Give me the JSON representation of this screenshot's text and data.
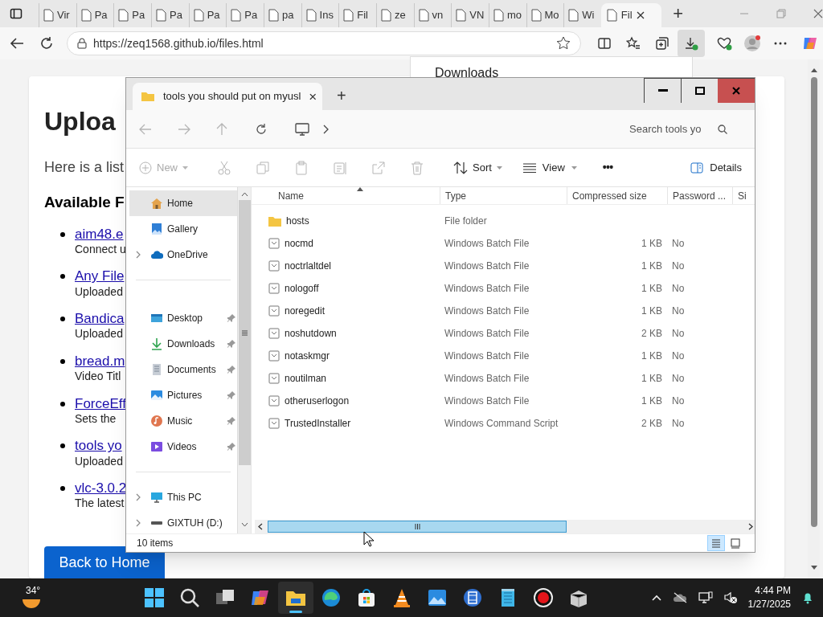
{
  "browser": {
    "tabs": [
      {
        "label": "Vir",
        "selected": false
      },
      {
        "label": "Pa",
        "selected": false
      },
      {
        "label": "Pa",
        "selected": false
      },
      {
        "label": "Pa",
        "selected": false
      },
      {
        "label": "Pa",
        "selected": false
      },
      {
        "label": "Pa",
        "selected": false
      },
      {
        "label": "pa",
        "selected": false
      },
      {
        "label": "Ins",
        "selected": false
      },
      {
        "label": "Fil",
        "selected": false
      },
      {
        "label": "ze",
        "selected": false
      },
      {
        "label": "vn",
        "selected": false
      },
      {
        "label": "VN",
        "selected": false
      },
      {
        "label": "mo",
        "selected": false
      },
      {
        "label": "Mo",
        "selected": false
      },
      {
        "label": "Wi",
        "selected": false
      },
      {
        "label": "Fil",
        "selected": true
      }
    ],
    "new_tab": "+",
    "url": "https://zeq1568.github.io/files.html",
    "downloads_panel": {
      "title": "Downloads"
    }
  },
  "page": {
    "heading": "Uploa",
    "intro": "Here is a list",
    "subheading": "Available F",
    "files": [
      {
        "link": "aim48.e",
        "note": "Connect u"
      },
      {
        "link": "Any File",
        "note": "Uploaded"
      },
      {
        "link": "Bandica",
        "note": "Uploaded"
      },
      {
        "link": "bread.m",
        "note": "Video Titl"
      },
      {
        "link": "ForceEff",
        "note": "Sets the"
      },
      {
        "link": "tools yo",
        "note": "Uploaded"
      },
      {
        "link": "vlc-3.0.2",
        "note": "The latest"
      }
    ],
    "back_button": "Back to Home"
  },
  "explorer": {
    "tab_title": "tools you should put on myusl",
    "tab_close": "×",
    "new_tab": "+",
    "search": {
      "placeholder": "Search tools yo"
    },
    "commands": [
      {
        "label": "New",
        "kind": "new",
        "disabled": true
      },
      {
        "label": "Sort",
        "kind": "sort",
        "disabled": false
      },
      {
        "label": "View",
        "kind": "view",
        "disabled": false
      },
      {
        "label": "•••",
        "kind": "more",
        "disabled": false
      },
      {
        "label": "Details",
        "kind": "details",
        "disabled": false
      }
    ],
    "sidebar": {
      "sections": [
        [
          {
            "label": "Home",
            "selected": true,
            "expandable": false,
            "pinned": false
          },
          {
            "label": "Gallery",
            "selected": false,
            "expandable": false,
            "pinned": false
          },
          {
            "label": "OneDrive",
            "selected": false,
            "expandable": true,
            "pinned": false
          }
        ],
        [
          {
            "label": "Desktop",
            "selected": false,
            "expandable": false,
            "pinned": true
          },
          {
            "label": "Downloads",
            "selected": false,
            "expandable": false,
            "pinned": true
          },
          {
            "label": "Documents",
            "selected": false,
            "expandable": false,
            "pinned": true
          },
          {
            "label": "Pictures",
            "selected": false,
            "expandable": false,
            "pinned": true
          },
          {
            "label": "Music",
            "selected": false,
            "expandable": false,
            "pinned": true
          },
          {
            "label": "Videos",
            "selected": false,
            "expandable": false,
            "pinned": true
          }
        ],
        [
          {
            "label": "This PC",
            "selected": false,
            "expandable": true,
            "pinned": false
          },
          {
            "label": "GIXTUH (D:)",
            "selected": false,
            "expandable": true,
            "pinned": false
          }
        ]
      ]
    },
    "table": {
      "columns": [
        "Name",
        "Type",
        "Compressed size",
        "Password ...",
        "Si"
      ],
      "rows": [
        {
          "kind": "folder",
          "name": "hosts",
          "type": "File folder",
          "size": "",
          "password": ""
        },
        {
          "kind": "file",
          "name": "nocmd",
          "type": "Windows Batch File",
          "size": "1 KB",
          "password": "No"
        },
        {
          "kind": "file",
          "name": "noctrlaltdel",
          "type": "Windows Batch File",
          "size": "1 KB",
          "password": "No"
        },
        {
          "kind": "file",
          "name": "nologoff",
          "type": "Windows Batch File",
          "size": "1 KB",
          "password": "No"
        },
        {
          "kind": "file",
          "name": "noregedit",
          "type": "Windows Batch File",
          "size": "1 KB",
          "password": "No"
        },
        {
          "kind": "file",
          "name": "noshutdown",
          "type": "Windows Batch File",
          "size": "2 KB",
          "password": "No"
        },
        {
          "kind": "file",
          "name": "notaskmgr",
          "type": "Windows Batch File",
          "size": "1 KB",
          "password": "No"
        },
        {
          "kind": "file",
          "name": "noutilman",
          "type": "Windows Batch File",
          "size": "1 KB",
          "password": "No"
        },
        {
          "kind": "file",
          "name": "otheruserlogon",
          "type": "Windows Batch File",
          "size": "1 KB",
          "password": "No"
        },
        {
          "kind": "file",
          "name": "TrustedInstaller",
          "type": "Windows Command Script",
          "size": "2 KB",
          "password": "No"
        }
      ]
    },
    "status": "10 items",
    "view_modes": [
      {
        "selected": true
      },
      {
        "selected": false
      }
    ]
  },
  "taskbar": {
    "weather": "34°",
    "apps": [
      {
        "selected": false
      },
      {
        "selected": false
      },
      {
        "selected": false
      },
      {
        "selected": false
      },
      {
        "selected": true
      },
      {
        "selected": false
      },
      {
        "selected": false
      },
      {
        "selected": false
      },
      {
        "selected": false
      },
      {
        "selected": false
      },
      {
        "selected": false
      },
      {
        "selected": false
      },
      {
        "selected": false
      }
    ],
    "time": "4:44 PM",
    "date": "1/27/2025"
  }
}
